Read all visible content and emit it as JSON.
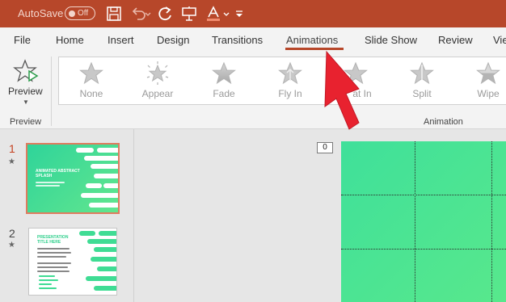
{
  "titlebar": {
    "autosave_label": "AutoSave",
    "autosave_state": "Off",
    "icons": [
      "save-icon",
      "undo-icon",
      "redo-icon",
      "present-icon",
      "font-color-icon",
      "customize-dropdown-icon"
    ],
    "background_color": "#b7472a"
  },
  "tabs": [
    {
      "label": "File"
    },
    {
      "label": "Home"
    },
    {
      "label": "Insert"
    },
    {
      "label": "Design"
    },
    {
      "label": "Transitions"
    },
    {
      "label": "Animations",
      "active": true
    },
    {
      "label": "Slide Show"
    },
    {
      "label": "Review"
    },
    {
      "label": "Vie"
    }
  ],
  "ribbon": {
    "preview_button_label": "Preview",
    "preview_group_label": "Preview",
    "animation_group_label": "Animation",
    "animations": [
      {
        "label": "None",
        "icon": "star-none-icon"
      },
      {
        "label": "Appear",
        "icon": "star-appear-icon"
      },
      {
        "label": "Fade",
        "icon": "star-fade-icon"
      },
      {
        "label": "Fly In",
        "icon": "star-fly-in-icon"
      },
      {
        "label": "Float In",
        "icon": "star-float-in-icon"
      },
      {
        "label": "Split",
        "icon": "star-split-icon"
      },
      {
        "label": "Wipe",
        "icon": "star-wipe-icon"
      }
    ],
    "visible_float_in_label": "at In"
  },
  "slides": [
    {
      "number": "1",
      "has_animation_mark": true,
      "title": "ANIMATED ABSTRACT SPLASH",
      "active": true
    },
    {
      "number": "2",
      "has_animation_mark": true,
      "title": "PRESENTATION TITLE HERE",
      "active": false
    }
  ],
  "main_slide": {
    "animation_badge": "0"
  },
  "annotation": {
    "arrow_color": "#e8222f",
    "points_to": "Animations tab"
  },
  "colors": {
    "accent": "#b7472a",
    "slide_green": "#4ae693"
  }
}
